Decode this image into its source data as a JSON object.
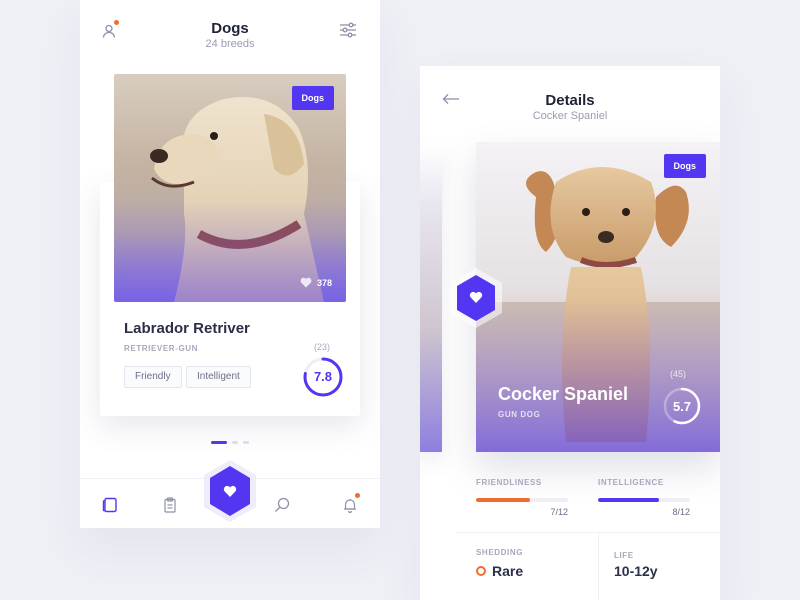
{
  "left": {
    "title": "Dogs",
    "subtitle": "24 breeds",
    "card": {
      "badge": "Dogs",
      "likes": "378",
      "name": "Labrador Retriver",
      "group": "RETRIEVER-GUN",
      "tags": [
        "Friendly",
        "Intelligent"
      ],
      "score": "7.8",
      "score_value": 0.78,
      "votes": "(23)"
    },
    "pagination": {
      "count": 3,
      "active": 0
    },
    "nav": {
      "items": [
        "cards-icon",
        "clipboard-icon",
        "favorites-icon",
        "search-icon",
        "bell-icon"
      ],
      "active": "cards-icon"
    }
  },
  "right": {
    "title": "Details",
    "subtitle": "Cocker Spaniel",
    "card": {
      "badge": "Dogs",
      "name": "Cocker Spaniel",
      "group": "GUN DOG",
      "score": "5.7",
      "score_value": 0.57,
      "votes": "(45)"
    },
    "stats": {
      "friendliness": {
        "label": "FRIENDLINESS",
        "value_text": "7/12",
        "value": 0.5833
      },
      "intelligence": {
        "label": "INTELLIGENCE",
        "value_text": "8/12",
        "value": 0.6667
      }
    },
    "info": {
      "shedding_label": "SHEDDING",
      "shedding_value": "Rare",
      "life_label": "LIFE",
      "life_value": "10-12y"
    }
  },
  "colors": {
    "accent": "#5236f1",
    "orange": "#f26b2e",
    "background": "#eff0f6"
  }
}
